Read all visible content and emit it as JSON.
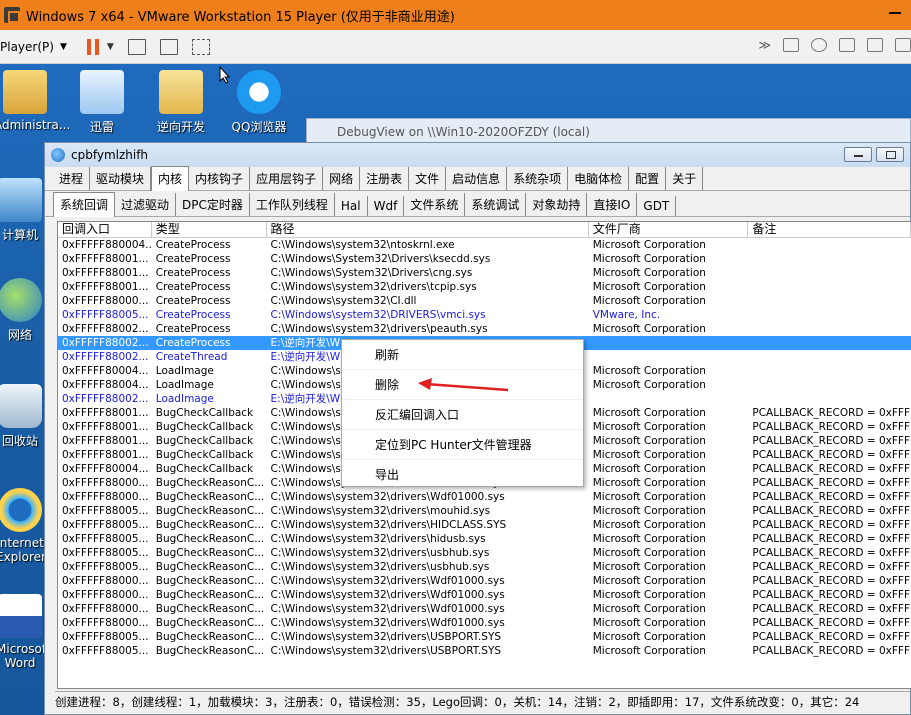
{
  "vmware": {
    "title": "Windows 7 x64 - VMware Workstation 15 Player (仅用于非商业用途)",
    "player_menu": "Player(P)"
  },
  "desktop": {
    "icons": [
      {
        "label": "Administra..."
      },
      {
        "label": "迅雷"
      },
      {
        "label": "逆向开发"
      },
      {
        "label": "QQ浏览器"
      },
      {
        "label": "计算机"
      },
      {
        "label": "网络"
      },
      {
        "label": "回收站"
      },
      {
        "label": "Internet Explorer"
      },
      {
        "label": "Microsoft Word"
      }
    ],
    "background_window_title": "DebugView on \\\\Win10-2020OFZDY (local)"
  },
  "window": {
    "title": "cpbfymlzhifh",
    "tabs_main": [
      "进程",
      "驱动模块",
      "内核",
      "内核钩子",
      "应用层钩子",
      "网络",
      "注册表",
      "文件",
      "启动信息",
      "系统杂项",
      "电脑体检",
      "配置",
      "关于"
    ],
    "tabs_main_active": "内核",
    "tabs_sub": [
      "系统回调",
      "过滤驱动",
      "DPC定时器",
      "工作队列线程",
      "Hal",
      "Wdf",
      "文件系统",
      "系统调试",
      "对象劫持",
      "直接IO",
      "GDT"
    ],
    "tabs_sub_active": "系统回调",
    "columns": [
      "回调入口",
      "类型",
      "路径",
      "文件厂商",
      "备注"
    ],
    "rows": [
      {
        "entry": "0xFFFFF880004...",
        "type": "CreateProcess",
        "path": "C:\\Windows\\system32\\ntoskrnl.exe",
        "vendor": "Microsoft Corporation",
        "note": "",
        "style": ""
      },
      {
        "entry": "0xFFFFF88001...",
        "type": "CreateProcess",
        "path": "C:\\Windows\\System32\\Drivers\\ksecdd.sys",
        "vendor": "Microsoft Corporation",
        "note": "",
        "style": ""
      },
      {
        "entry": "0xFFFFF88001...",
        "type": "CreateProcess",
        "path": "C:\\Windows\\System32\\Drivers\\cng.sys",
        "vendor": "Microsoft Corporation",
        "note": "",
        "style": ""
      },
      {
        "entry": "0xFFFFF88001...",
        "type": "CreateProcess",
        "path": "C:\\Windows\\system32\\drivers\\tcpip.sys",
        "vendor": "Microsoft Corporation",
        "note": "",
        "style": ""
      },
      {
        "entry": "0xFFFFF88000...",
        "type": "CreateProcess",
        "path": "C:\\Windows\\system32\\CI.dll",
        "vendor": "Microsoft Corporation",
        "note": "",
        "style": ""
      },
      {
        "entry": "0xFFFFF88005...",
        "type": "CreateProcess",
        "path": "C:\\Windows\\system32\\DRIVERS\\vmci.sys",
        "vendor": "VMware, Inc.",
        "note": "",
        "style": "blue"
      },
      {
        "entry": "0xFFFFF88002...",
        "type": "CreateProcess",
        "path": "C:\\Windows\\system32\\drivers\\peauth.sys",
        "vendor": "Microsoft Corporation",
        "note": "",
        "style": ""
      },
      {
        "entry": "0xFFFFF88002...",
        "type": "CreateProcess",
        "path": "E:\\逆向开发\\W",
        "vendor": "",
        "note": "",
        "style": "sel"
      },
      {
        "entry": "0xFFFFF88002...",
        "type": "CreateThread",
        "path": "E:\\逆向开发\\W",
        "vendor": "",
        "note": "",
        "style": "blue"
      },
      {
        "entry": "0xFFFFF80004...",
        "type": "LoadImage",
        "path": "C:\\Windows\\sy",
        "vendor": "Microsoft Corporation",
        "note": "",
        "style": ""
      },
      {
        "entry": "0xFFFFF88004...",
        "type": "LoadImage",
        "path": "C:\\Windows\\sy",
        "vendor": "Microsoft Corporation",
        "note": "",
        "style": ""
      },
      {
        "entry": "0xFFFFF88002...",
        "type": "LoadImage",
        "path": "E:\\逆向开发\\W",
        "vendor": "",
        "note": "",
        "style": "blue"
      },
      {
        "entry": "0xFFFFF88001...",
        "type": "BugCheckCallback",
        "path": "C:\\Windows\\sy",
        "vendor": "Microsoft Corporation",
        "note": "PCALLBACK_RECORD = 0xFFFFF",
        "style": ""
      },
      {
        "entry": "0xFFFFF88001...",
        "type": "BugCheckCallback",
        "path": "C:\\Windows\\sy",
        "vendor": "Microsoft Corporation",
        "note": "PCALLBACK_RECORD = 0xFFFFF",
        "style": ""
      },
      {
        "entry": "0xFFFFF88001...",
        "type": "BugCheckCallback",
        "path": "C:\\Windows\\sy",
        "vendor": "Microsoft Corporation",
        "note": "PCALLBACK_RECORD = 0xFFFFF",
        "style": ""
      },
      {
        "entry": "0xFFFFF88001...",
        "type": "BugCheckCallback",
        "path": "C:\\Windows\\sy",
        "vendor": "Microsoft Corporation",
        "note": "PCALLBACK_RECORD = 0xFFFFF",
        "style": ""
      },
      {
        "entry": "0xFFFFF80004...",
        "type": "BugCheckCallback",
        "path": "C:\\Windows\\sy",
        "vendor": "Microsoft Corporation",
        "note": "PCALLBACK_RECORD = 0xFFFFF",
        "style": ""
      },
      {
        "entry": "0xFFFFF88000...",
        "type": "BugCheckReasonC...",
        "path": "C:\\Windows\\system32\\drivers\\Wdf01000.sys",
        "vendor": "Microsoft Corporation",
        "note": "PCALLBACK_RECORD = 0xFFFFF",
        "style": ""
      },
      {
        "entry": "0xFFFFF88000...",
        "type": "BugCheckReasonC...",
        "path": "C:\\Windows\\system32\\drivers\\Wdf01000.sys",
        "vendor": "Microsoft Corporation",
        "note": "PCALLBACK_RECORD = 0xFFFFF",
        "style": ""
      },
      {
        "entry": "0xFFFFF88005...",
        "type": "BugCheckReasonC...",
        "path": "C:\\Windows\\system32\\drivers\\mouhid.sys",
        "vendor": "Microsoft Corporation",
        "note": "PCALLBACK_RECORD = 0xFFFFF",
        "style": ""
      },
      {
        "entry": "0xFFFFF88005...",
        "type": "BugCheckReasonC...",
        "path": "C:\\Windows\\system32\\drivers\\HIDCLASS.SYS",
        "vendor": "Microsoft Corporation",
        "note": "PCALLBACK_RECORD = 0xFFFFF",
        "style": ""
      },
      {
        "entry": "0xFFFFF88005...",
        "type": "BugCheckReasonC...",
        "path": "C:\\Windows\\system32\\drivers\\hidusb.sys",
        "vendor": "Microsoft Corporation",
        "note": "PCALLBACK_RECORD = 0xFFFFF",
        "style": ""
      },
      {
        "entry": "0xFFFFF88005...",
        "type": "BugCheckReasonC...",
        "path": "C:\\Windows\\system32\\drivers\\usbhub.sys",
        "vendor": "Microsoft Corporation",
        "note": "PCALLBACK_RECORD = 0xFFFFF",
        "style": ""
      },
      {
        "entry": "0xFFFFF88005...",
        "type": "BugCheckReasonC...",
        "path": "C:\\Windows\\system32\\drivers\\usbhub.sys",
        "vendor": "Microsoft Corporation",
        "note": "PCALLBACK_RECORD = 0xFFFFF",
        "style": ""
      },
      {
        "entry": "0xFFFFF88000...",
        "type": "BugCheckReasonC...",
        "path": "C:\\Windows\\system32\\drivers\\Wdf01000.sys",
        "vendor": "Microsoft Corporation",
        "note": "PCALLBACK_RECORD = 0xFFFFF",
        "style": ""
      },
      {
        "entry": "0xFFFFF88000...",
        "type": "BugCheckReasonC...",
        "path": "C:\\Windows\\system32\\drivers\\Wdf01000.sys",
        "vendor": "Microsoft Corporation",
        "note": "PCALLBACK_RECORD = 0xFFFFF",
        "style": ""
      },
      {
        "entry": "0xFFFFF88000...",
        "type": "BugCheckReasonC...",
        "path": "C:\\Windows\\system32\\drivers\\Wdf01000.sys",
        "vendor": "Microsoft Corporation",
        "note": "PCALLBACK_RECORD = 0xFFFFF",
        "style": ""
      },
      {
        "entry": "0xFFFFF88000...",
        "type": "BugCheckReasonC...",
        "path": "C:\\Windows\\system32\\drivers\\Wdf01000.sys",
        "vendor": "Microsoft Corporation",
        "note": "PCALLBACK_RECORD = 0xFFFFF",
        "style": ""
      },
      {
        "entry": "0xFFFFF88005...",
        "type": "BugCheckReasonC...",
        "path": "C:\\Windows\\system32\\drivers\\USBPORT.SYS",
        "vendor": "Microsoft Corporation",
        "note": "PCALLBACK_RECORD = 0xFFFFF",
        "style": ""
      },
      {
        "entry": "0xFFFFF88005...",
        "type": "BugCheckReasonC...",
        "path": "C:\\Windows\\system32\\drivers\\USBPORT.SYS",
        "vendor": "Microsoft Corporation",
        "note": "PCALLBACK_RECORD = 0xFFFFF",
        "style": ""
      }
    ],
    "status": "创建进程：8，创建线程：1，加载模块：3，注册表：0，错误检测：35，Lego回调：0，关机：14，注销：2，即插即用：17，文件系统改变：0，其它：24"
  },
  "context_menu": {
    "items": [
      "刷新",
      "删除",
      "反汇编回调入口",
      "定位到PC Hunter文件管理器",
      "导出"
    ]
  },
  "colors": {
    "vm_titlebar": "#ef7f1a",
    "selection": "#3399ff",
    "highlight_text": "#1a1ae0",
    "annotation_arrow": "#e02020"
  }
}
